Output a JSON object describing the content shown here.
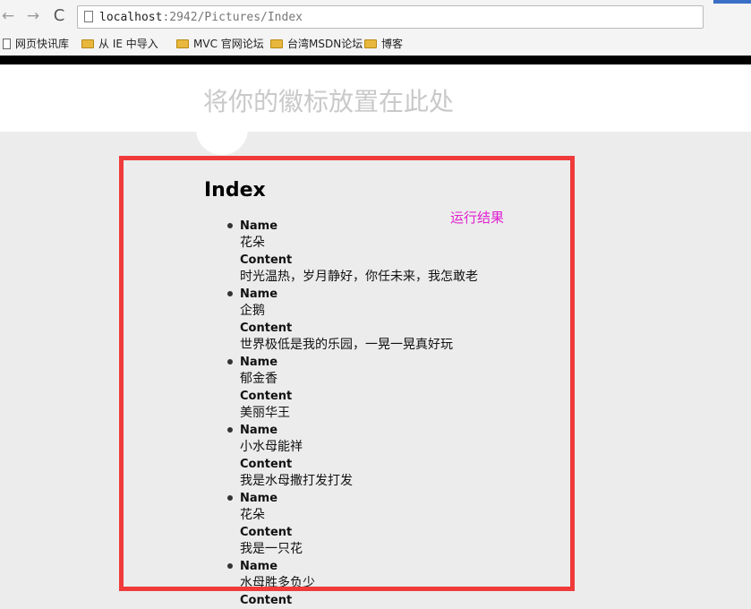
{
  "browser": {
    "url_host": "localhost",
    "url_path": ":2942/Pictures/Index",
    "nav_back": "←",
    "nav_forward": "→",
    "nav_reload": "C",
    "bookmarks": [
      {
        "label": "网页快讯库",
        "icon": "file-icon"
      },
      {
        "label": "从 IE 中导入",
        "icon": "folder-icon"
      },
      {
        "label": "MVC 官网论坛",
        "icon": "folder-icon"
      },
      {
        "label": "台湾MSDN论坛",
        "icon": "folder-icon"
      },
      {
        "label": "博客",
        "icon": "folder-icon"
      }
    ]
  },
  "header": {
    "logo_placeholder": "将你的徽标放置在此处"
  },
  "main": {
    "heading": "Index",
    "annotation": "运行结果",
    "annotation_color": "#e020d0",
    "highlight_color": "#f03a3a",
    "name_label": "Name",
    "content_label": "Content",
    "items": [
      {
        "name": "花朵",
        "content": "时光温热，岁月静好，你任未来，我怎敢老"
      },
      {
        "name": "企鹅",
        "content": "世界极低是我的乐园，一晃一晃真好玩"
      },
      {
        "name": "郁金香",
        "content": "美丽华王"
      },
      {
        "name": "小水母能祥",
        "content": "我是水母撒打发打发"
      },
      {
        "name": "花朵",
        "content": "我是一只花"
      },
      {
        "name": "水母胜多负少",
        "content": ""
      }
    ]
  }
}
